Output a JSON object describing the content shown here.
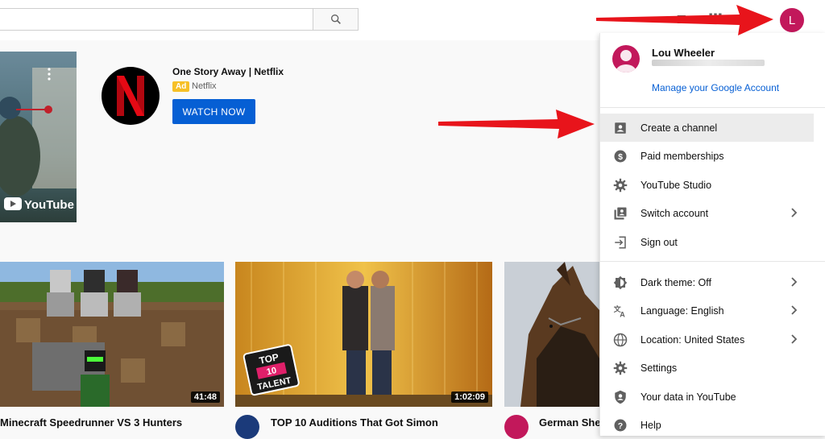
{
  "header": {
    "search_placeholder": "",
    "avatar_letter": "L"
  },
  "ad": {
    "title": "One Story Away | Netflix",
    "badge": "Ad",
    "advertiser": "Netflix",
    "cta": "WATCH NOW",
    "thumb_watermark": "YouTube"
  },
  "videos": [
    {
      "title": "Minecraft Speedrunner VS 3 Hunters",
      "duration": "41:48"
    },
    {
      "title": "TOP 10 Auditions That Got Simon",
      "duration": "1:02:09",
      "badge_top": "TOP",
      "badge_mid": "10",
      "badge_bottom": "TALENT"
    },
    {
      "title": "German She",
      "duration": ""
    }
  ],
  "account_menu": {
    "user_name": "Lou Wheeler",
    "manage_link": "Manage your Google Account",
    "items": [
      {
        "label": "Create a channel",
        "icon": "person-box-icon"
      },
      {
        "label": "Paid memberships",
        "icon": "dollar-icon"
      },
      {
        "label": "YouTube Studio",
        "icon": "gear-icon"
      },
      {
        "label": "Switch account",
        "icon": "switch-account-icon"
      },
      {
        "label": "Sign out",
        "icon": "sign-out-icon"
      },
      {
        "label": "Dark theme: Off",
        "icon": "dark-theme-icon"
      },
      {
        "label": "Language: English",
        "icon": "translate-icon"
      },
      {
        "label": "Location: United States",
        "icon": "globe-icon"
      },
      {
        "label": "Settings",
        "icon": "gear-icon"
      },
      {
        "label": "Your data in YouTube",
        "icon": "shield-person-icon"
      },
      {
        "label": "Help",
        "icon": "help-icon"
      }
    ]
  },
  "colors": {
    "accent_blue": "#065fd4",
    "avatar": "#c2185b",
    "annotation_arrow": "#e8141b",
    "ad_badge": "#f6c026"
  }
}
